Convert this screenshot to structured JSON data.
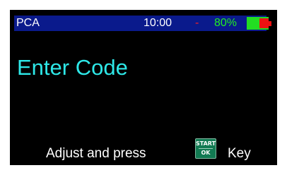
{
  "status_bar": {
    "device": "PCA",
    "time": "10:00",
    "separator": "-",
    "battery": "80%",
    "battery_level": 0.8
  },
  "main": {
    "title": "Enter Code"
  },
  "footer": {
    "prompt_before": "Adjust and press",
    "key_top": "START",
    "key_bottom": "OK",
    "prompt_after": "Key"
  },
  "colors": {
    "status_bg": "#0a1a8c",
    "title": "#2ee8e8",
    "battery_ok": "#22dd22",
    "battery_warn": "#ee1111",
    "key_bg": "#127a52"
  }
}
